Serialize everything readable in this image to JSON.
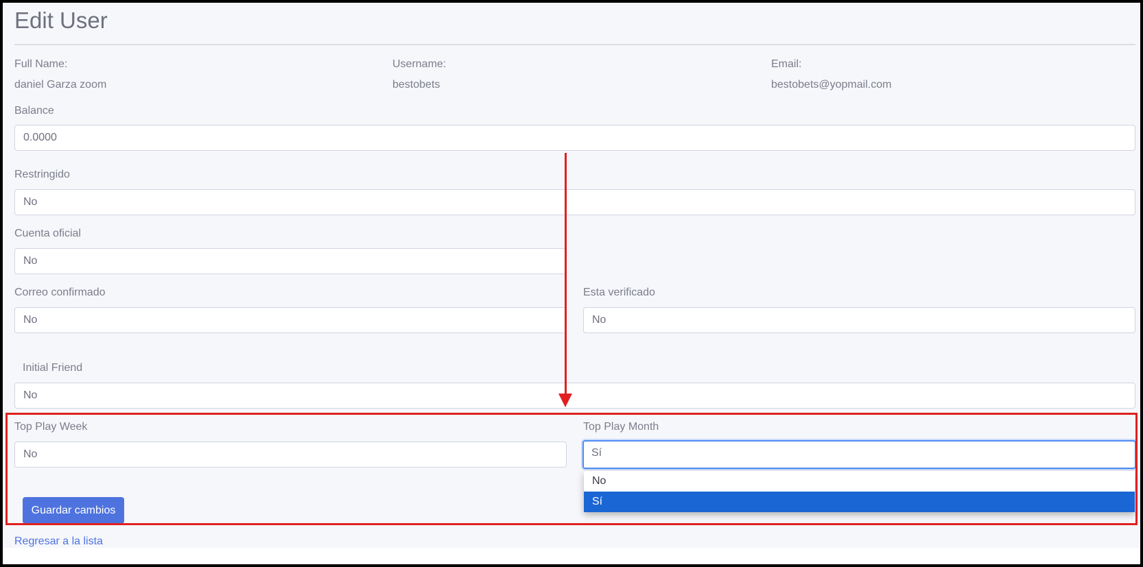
{
  "page": {
    "title": "Edit User"
  },
  "info": {
    "full_name_label": "Full Name:",
    "full_name_value": "daniel Garza zoom",
    "username_label": "Username:",
    "username_value": "bestobets",
    "email_label": "Email:",
    "email_value": "bestobets@yopmail.com"
  },
  "form": {
    "balance": {
      "label": "Balance",
      "value": "0.0000"
    },
    "restringido": {
      "label": "Restringido",
      "value": "No"
    },
    "cuenta_oficial": {
      "label": "Cuenta oficial",
      "value": "No"
    },
    "correo_confirmado": {
      "label": "Correo confirmado",
      "value": "No"
    },
    "esta_verificado": {
      "label": "Esta verificado",
      "value": "No"
    },
    "initial_friend": {
      "label": "Initial Friend",
      "value": "No"
    },
    "top_play_week": {
      "label": "Top Play Week",
      "value": "No"
    },
    "top_play_month": {
      "label": "Top Play Month",
      "value": "Sí",
      "options": [
        "No",
        "Sí"
      ],
      "highlighted_option": "Sí"
    },
    "save_label": "Guardar cambios",
    "back_link": "Regresar a la lista"
  },
  "annotation": {
    "color": "#e02020"
  },
  "colors": {
    "primary": "#4e73df",
    "selected_option": "#1a66d4",
    "focus": "#4e8cf5"
  }
}
